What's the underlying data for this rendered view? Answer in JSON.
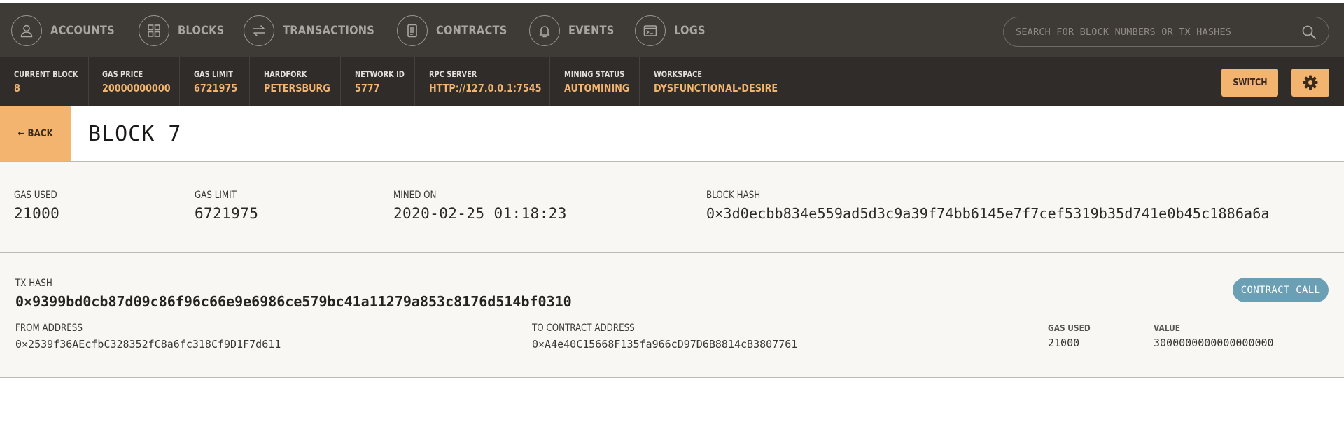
{
  "nav": {
    "items": [
      {
        "label": "ACCOUNTS",
        "icon": "user-icon"
      },
      {
        "label": "BLOCKS",
        "icon": "grid-icon"
      },
      {
        "label": "TRANSACTIONS",
        "icon": "swap-arrows-icon"
      },
      {
        "label": "CONTRACTS",
        "icon": "document-icon"
      },
      {
        "label": "EVENTS",
        "icon": "bell-icon"
      },
      {
        "label": "LOGS",
        "icon": "terminal-icon"
      }
    ],
    "search_placeholder": "SEARCH FOR BLOCK NUMBERS OR TX HASHES"
  },
  "status": {
    "items": [
      {
        "label": "CURRENT BLOCK",
        "value": "8"
      },
      {
        "label": "GAS PRICE",
        "value": "20000000000"
      },
      {
        "label": "GAS LIMIT",
        "value": "6721975"
      },
      {
        "label": "HARDFORK",
        "value": "PETERSBURG"
      },
      {
        "label": "NETWORK ID",
        "value": "5777"
      },
      {
        "label": "RPC SERVER",
        "value": "HTTP://127.0.0.1:7545"
      },
      {
        "label": "MINING STATUS",
        "value": "AUTOMINING"
      },
      {
        "label": "WORKSPACE",
        "value": "DYSFUNCTIONAL-DESIRE"
      }
    ],
    "switch_label": "SWITCH"
  },
  "title": {
    "back_label": "← BACK",
    "text": "BLOCK 7"
  },
  "block": {
    "gas_used_label": "GAS USED",
    "gas_used": "21000",
    "gas_limit_label": "GAS LIMIT",
    "gas_limit": "6721975",
    "mined_on_label": "MINED ON",
    "mined_on": "2020-02-25 01:18:23",
    "hash_label": "BLOCK HASH",
    "hash": "0×3d0ecbb834e559ad5d3c9a39f74bb6145e7f7cef5319b35d741e0b45c1886a6a"
  },
  "tx": {
    "hash_label": "TX HASH",
    "hash": "0×9399bd0cb87d09c86f96c66e9e6986ce579bc41a11279a853c8176d514bf0310",
    "badge": "CONTRACT CALL",
    "from_label": "FROM ADDRESS",
    "from": "0×2539f36AEcfbC328352fC8a6fc318Cf9D1F7d611",
    "to_label": "TO CONTRACT ADDRESS",
    "to": "0×A4e40C15668F135fa966cD97D6B8814cB3807761",
    "gas_used_label": "GAS USED",
    "gas_used": "21000",
    "value_label": "VALUE",
    "value": "3000000000000000000"
  },
  "colors": {
    "accent": "#f2b46f",
    "nav_bg": "#3e3a36",
    "status_bg": "#2f2c29",
    "badge_bg": "#6a9fb4"
  }
}
